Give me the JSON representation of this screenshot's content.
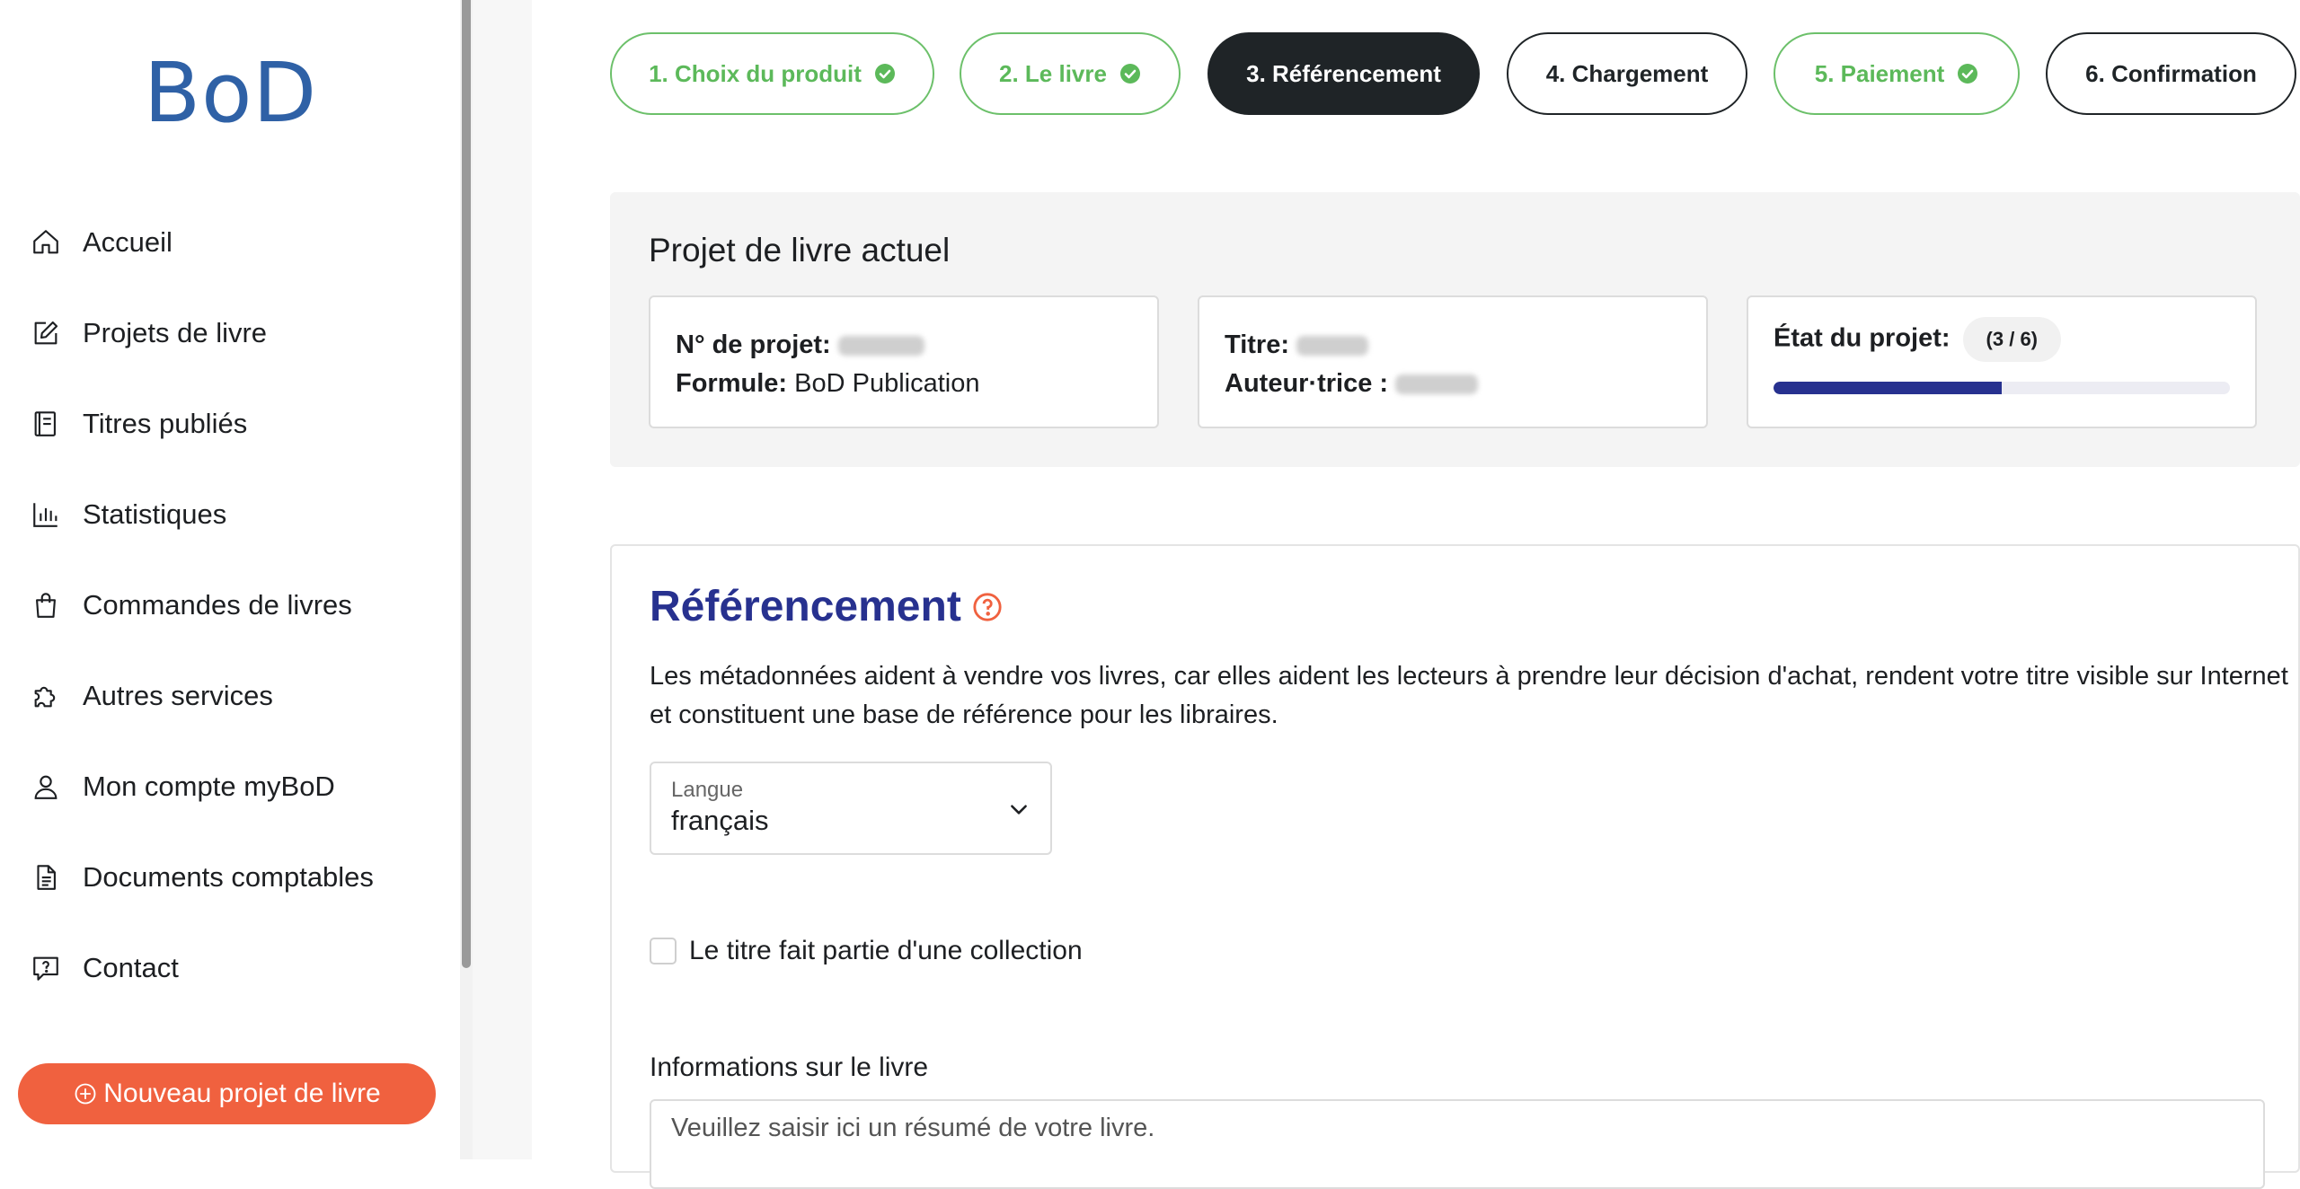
{
  "brand": {
    "logo_text": "BoD",
    "logo_color": "#2f61a6"
  },
  "sidebar": {
    "items": [
      {
        "label": "Accueil",
        "icon": "home-icon"
      },
      {
        "label": "Projets de livre",
        "icon": "edit-icon"
      },
      {
        "label": "Titres publiés",
        "icon": "book-icon"
      },
      {
        "label": "Statistiques",
        "icon": "bar-chart-icon"
      },
      {
        "label": "Commandes de livres",
        "icon": "shopping-bag-icon"
      },
      {
        "label": "Autres services",
        "icon": "puzzle-icon"
      },
      {
        "label": "Mon compte myBoD",
        "icon": "user-icon"
      },
      {
        "label": "Documents comptables",
        "icon": "document-icon"
      },
      {
        "label": "Contact",
        "icon": "help-chat-icon"
      }
    ],
    "new_project_label": "Nouveau projet de livre",
    "new_project_color": "#f0613f"
  },
  "stepper": {
    "steps": [
      {
        "label": "1. Choix du produit",
        "status": "done"
      },
      {
        "label": "2. Le livre",
        "status": "done"
      },
      {
        "label": "3. Référencement",
        "status": "active"
      },
      {
        "label": "4. Chargement",
        "status": "todo"
      },
      {
        "label": "5. Paiement",
        "status": "done"
      },
      {
        "label": "6. Confirmation",
        "status": "todo"
      }
    ],
    "done_color": "#5cb95a",
    "active_color": "#1f2427"
  },
  "project": {
    "title": "Projet de livre actuel",
    "project_no_label": "N° de projet:",
    "formula_label": "Formule:",
    "formula_value": "BoD Publication",
    "title_label": "Titre:",
    "author_label": "Auteur·trice :",
    "state_label": "État du projet:",
    "state_badge": "(3 / 6)",
    "progress_fraction": 0.5,
    "progress_color": "#27318f"
  },
  "referencing": {
    "title": "Référencement",
    "help_icon": "question-circle-icon",
    "description": "Les métadonnées aident à vendre vos livres, car elles aident les lecteurs à prendre leur décision d'achat, rendent votre titre visible sur Internet et constituent une base de référence pour les libraires.",
    "language_label": "Langue",
    "language_value": "français",
    "collection_label": "Le titre fait partie d'une collection",
    "collection_checked": false,
    "info_label": "Informations sur le livre",
    "summary_placeholder": "Veuillez saisir ici un résumé de votre livre.",
    "title_color": "#27318f"
  }
}
